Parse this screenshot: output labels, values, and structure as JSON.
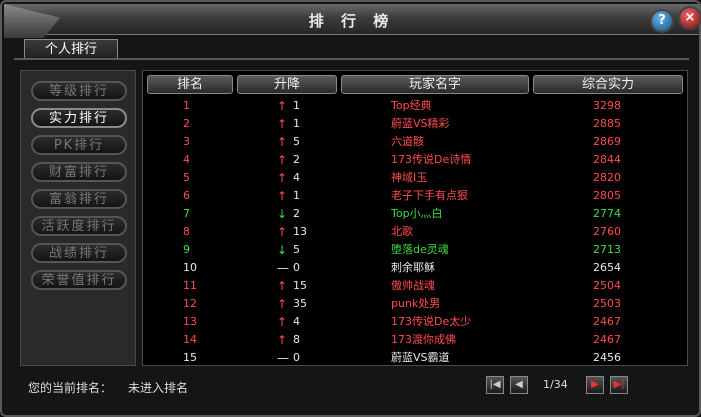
{
  "window": {
    "title": "排 行 榜",
    "help_label": "?",
    "close_label": "×"
  },
  "tab": {
    "label": "个人排行"
  },
  "sidebar": {
    "items": [
      {
        "label": "等级排行"
      },
      {
        "label": "实力排行"
      },
      {
        "label": "PK排行"
      },
      {
        "label": "财富排行"
      },
      {
        "label": "富翁排行"
      },
      {
        "label": "活跃度排行"
      },
      {
        "label": "战绩排行"
      },
      {
        "label": "荣誉值排行"
      }
    ]
  },
  "table": {
    "headers": [
      "排名",
      "升降",
      "玩家名字",
      "综合实力"
    ],
    "colors": {
      "up": "#ff4d4d",
      "down": "#3fdc3f",
      "flat": "#e8e8e8"
    },
    "rows": [
      {
        "rank": "1",
        "arrow": "↑",
        "change": "1",
        "name": "Top经典",
        "score": "3298",
        "trend": "up"
      },
      {
        "rank": "2",
        "arrow": "↑",
        "change": "1",
        "name": "蔚蓝VS精彩",
        "score": "2885",
        "trend": "up"
      },
      {
        "rank": "3",
        "arrow": "↑",
        "change": "5",
        "name": "六道骸",
        "score": "2869",
        "trend": "up"
      },
      {
        "rank": "4",
        "arrow": "↑",
        "change": "2",
        "name": "173传说De诗情",
        "score": "2844",
        "trend": "up"
      },
      {
        "rank": "5",
        "arrow": "↑",
        "change": "4",
        "name": "神域I玉",
        "score": "2820",
        "trend": "up"
      },
      {
        "rank": "6",
        "arrow": "↑",
        "change": "1",
        "name": "老子下手有点狠",
        "score": "2805",
        "trend": "up"
      },
      {
        "rank": "7",
        "arrow": "↓",
        "change": "2",
        "name": "Top小灬白",
        "score": "2774",
        "trend": "down"
      },
      {
        "rank": "8",
        "arrow": "↑",
        "change": "13",
        "name": "北歌",
        "score": "2760",
        "trend": "up"
      },
      {
        "rank": "9",
        "arrow": "↓",
        "change": "5",
        "name": "堕落de灵魂",
        "score": "2713",
        "trend": "down"
      },
      {
        "rank": "10",
        "arrow": "—",
        "change": "0",
        "name": "刺余耶稣",
        "score": "2654",
        "trend": "flat"
      },
      {
        "rank": "11",
        "arrow": "↑",
        "change": "15",
        "name": "傲帅战魂",
        "score": "2504",
        "trend": "up"
      },
      {
        "rank": "12",
        "arrow": "↑",
        "change": "35",
        "name": "punk处男",
        "score": "2503",
        "trend": "up"
      },
      {
        "rank": "13",
        "arrow": "↑",
        "change": "4",
        "name": "173传说De太少",
        "score": "2467",
        "trend": "up"
      },
      {
        "rank": "14",
        "arrow": "↑",
        "change": "8",
        "name": "173渡你成佛",
        "score": "2467",
        "trend": "up"
      },
      {
        "rank": "15",
        "arrow": "—",
        "change": "0",
        "name": "蔚蓝VS霸道",
        "score": "2456",
        "trend": "flat"
      }
    ]
  },
  "footer": {
    "current_rank_label": "您的当前排名：",
    "current_rank_value": "未进入排名",
    "page": "1/34"
  },
  "pager_icons": [
    "first-page-icon",
    "prev-page-icon",
    "next-page-icon",
    "last-page-icon"
  ]
}
